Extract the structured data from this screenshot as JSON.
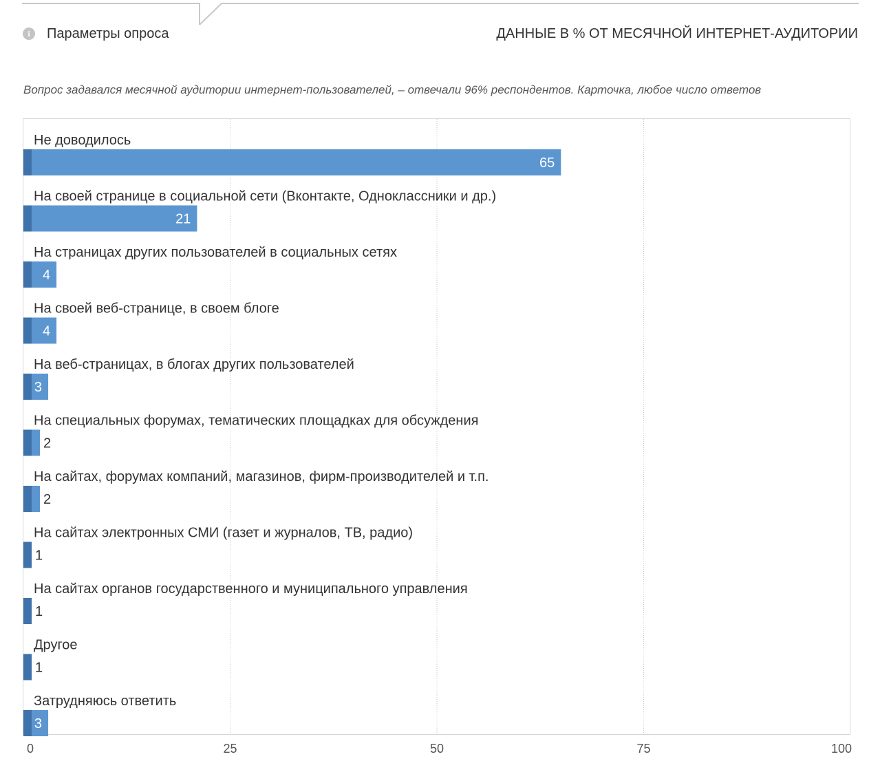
{
  "header": {
    "params_link": "Параметры опроса",
    "units_label": "ДАННЫЕ В % ОТ МЕСЯЧНОЙ ИНТЕРНЕТ-АУДИТОРИИ",
    "info_icon": "info-icon"
  },
  "question_text": "Вопрос задавался месячной аудитории интернет-пользователей, – отвечали 96% респондентов. Карточка, любое число ответов",
  "colors": {
    "bar": "#5b96d0",
    "bar_accent": "#3f72ab",
    "grid": "#c9c9c9",
    "frame": "#d5d5d5",
    "text": "#333333",
    "value_inside": "#ffffff"
  },
  "chart_data": {
    "type": "bar",
    "orientation": "horizontal",
    "categories": [
      "Не доводилось",
      "На своей странице в социальной сети (Вконтакте, Одноклассники и др.)",
      "На страницах других пользователей в социальных сетях",
      "На своей веб-странице, в своем блоге",
      "На веб-страницах, в блогах других пользователей",
      "На специальных форумах, тематических площадках для обсуждения",
      "На сайтах, форумах компаний, магазинов, фирм-производителей и т.п.",
      "На сайтах электронных СМИ (газет и журналов, ТВ, радио)",
      "На сайтах органов государственного и муниципального управления",
      "Другое",
      "Затрудняюсь ответить"
    ],
    "values": [
      65,
      21,
      4,
      4,
      3,
      2,
      2,
      1,
      1,
      1,
      3
    ],
    "xlim": [
      0,
      100
    ],
    "xticks": [
      0,
      25,
      50,
      75,
      100
    ],
    "grid": true,
    "xlabel": "",
    "ylabel": ""
  }
}
